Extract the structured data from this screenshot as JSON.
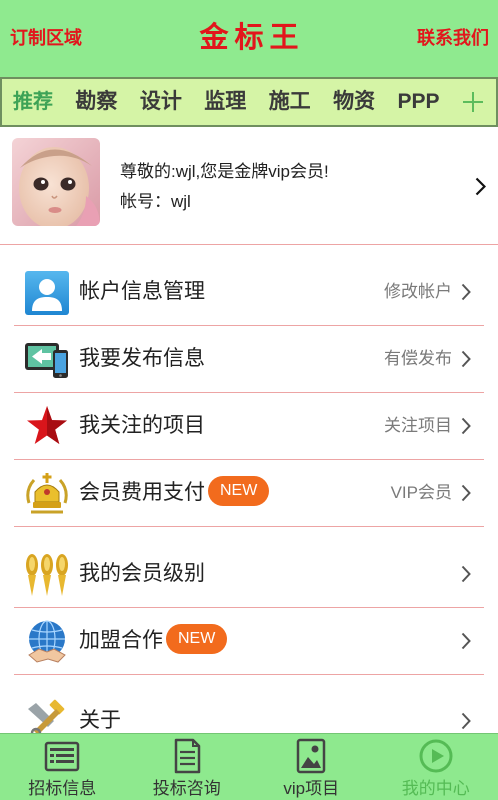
{
  "header": {
    "left": "订制区域",
    "title": "金标王",
    "right": "联系我们"
  },
  "tabs": [
    {
      "label": "推荐",
      "active": true
    },
    {
      "label": "勘察"
    },
    {
      "label": "设计"
    },
    {
      "label": "监理"
    },
    {
      "label": "施工"
    },
    {
      "label": "物资"
    },
    {
      "label": "PPP"
    }
  ],
  "add_tab_icon": "plus-icon",
  "user": {
    "avatar_icon": "baby-photo-avatar",
    "greeting": "尊敬的:wjl,您是金牌vip会员!",
    "account": "帐号：wjl"
  },
  "menu": [
    {
      "label": "帐户信息管理",
      "action": "修改帐户",
      "icon": "user-icon"
    },
    {
      "label": "我要发布信息",
      "action": "有偿发布",
      "icon": "publish-device-icon"
    },
    {
      "label": "我关注的项目",
      "action": "关注项目",
      "icon": "red-star-icon"
    },
    {
      "label": "会员费用支付",
      "badge": "NEW",
      "action": "VIP会员",
      "icon": "crown-icon"
    },
    {
      "label": "我的会员级别",
      "icon": "medals-icon"
    },
    {
      "label": "加盟合作",
      "badge": "NEW",
      "icon": "globe-handshake-icon"
    },
    {
      "label": "关于",
      "icon": "tools-icon"
    }
  ],
  "bottom_nav": [
    {
      "label": "招标信息",
      "icon": "list-icon"
    },
    {
      "label": "投标咨询",
      "icon": "document-icon"
    },
    {
      "label": "vip项目",
      "icon": "image-icon"
    },
    {
      "label": "我的中心",
      "icon": "play-circle-icon",
      "active": true
    }
  ],
  "colors": {
    "header_bg": "#8fea8f",
    "tab_bar_bg": "#d5f4a6",
    "title_red": "#e2161c",
    "active_tab_green": "#3da356",
    "badge_orange": "#f26b1d",
    "divider_pink": "#eda4a4",
    "active_nav_green": "#55bb55"
  }
}
